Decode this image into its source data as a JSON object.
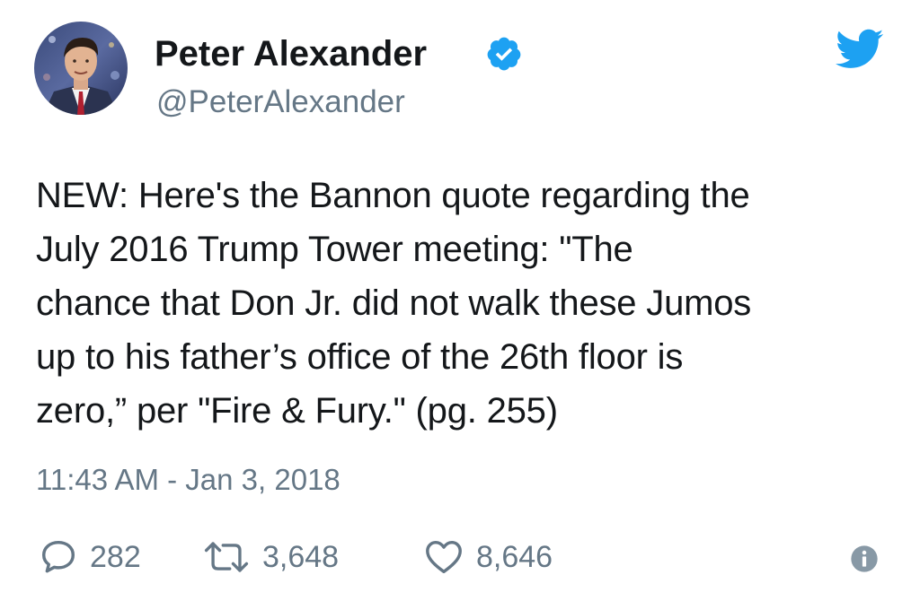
{
  "author": {
    "display_name": "Peter Alexander",
    "handle": "@PeterAlexander",
    "verified": true
  },
  "tweet": {
    "text_lines": [
      "NEW: Here's the Bannon quote regarding the",
      "July 2016 Trump Tower meeting: \"The",
      "chance that Don Jr. did not walk these Jumos",
      "up to his father’s office of the 26th floor is",
      "zero,” per \"Fire & Fury.\" (pg. 255)"
    ],
    "timestamp": "11:43 AM - Jan 3, 2018"
  },
  "actions": {
    "reply_count": "282",
    "retweet_count": "3,648",
    "like_count": "8,646"
  },
  "icons": {
    "brand": "twitter-bird-icon",
    "verified": "verified-badge-icon",
    "reply": "reply-icon",
    "retweet": "retweet-icon",
    "like": "heart-icon",
    "info": "info-icon"
  },
  "colors": {
    "brand_blue": "#1DA1F2",
    "text": "#14171A",
    "secondary": "#657786"
  }
}
